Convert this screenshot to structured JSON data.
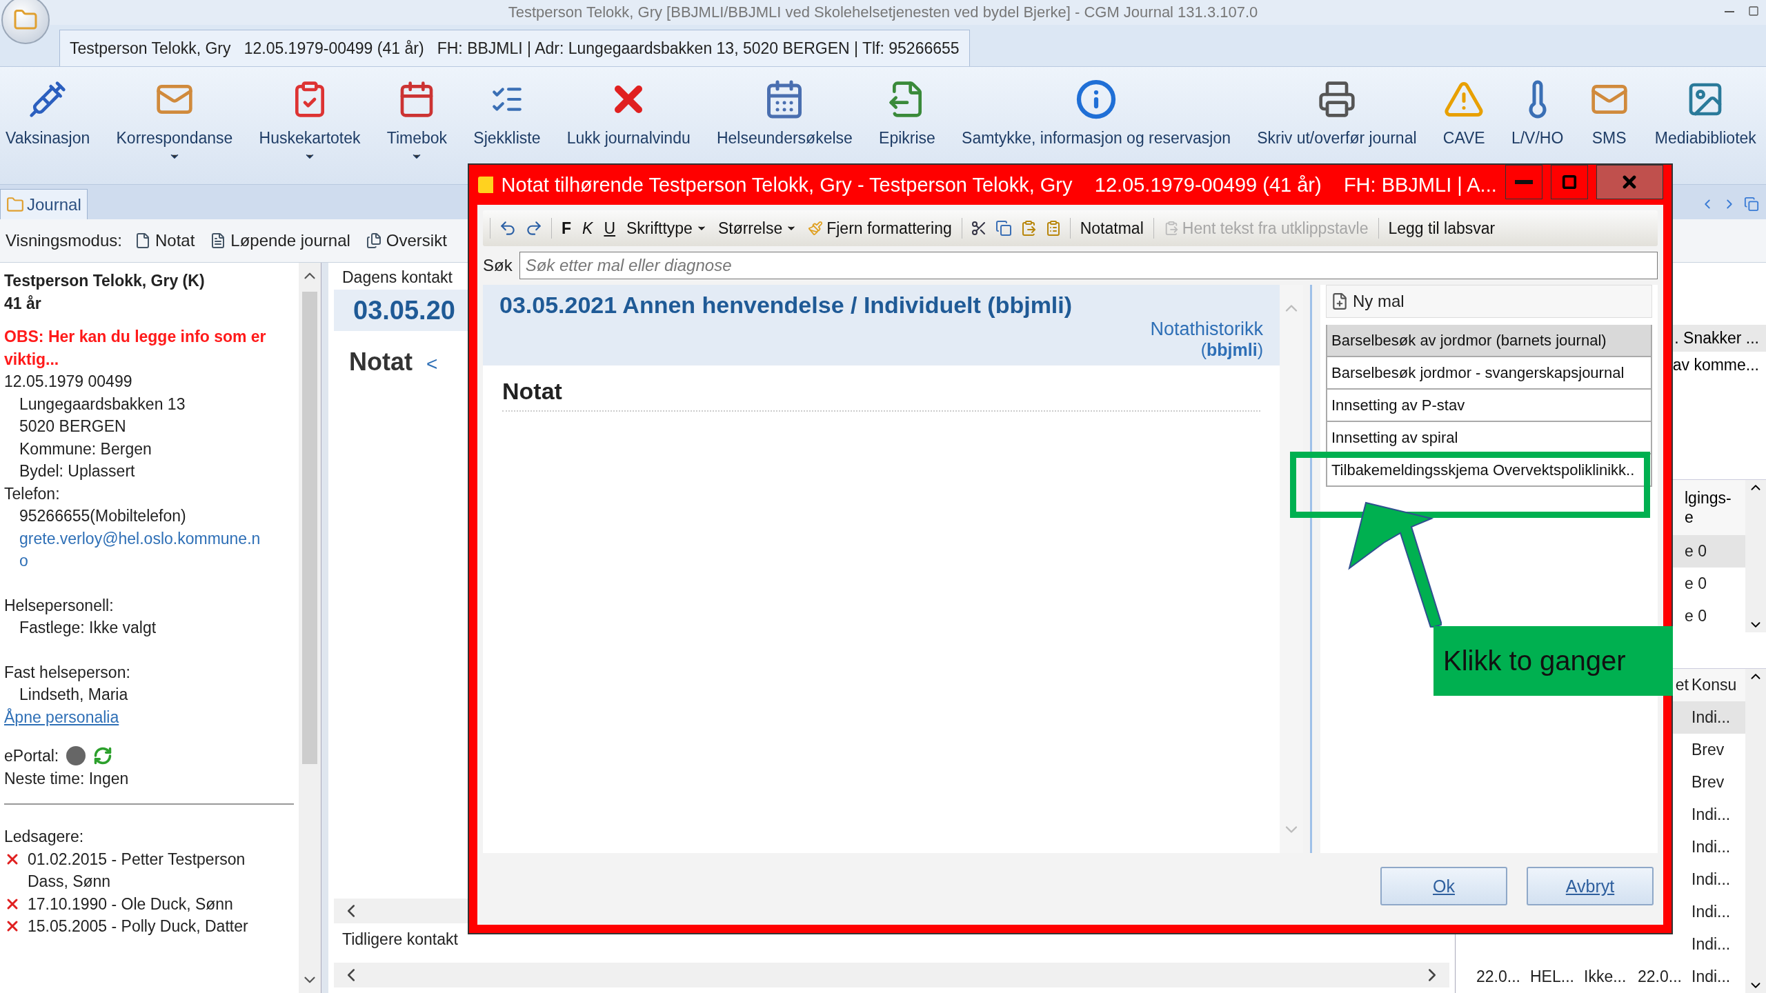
{
  "window": {
    "title": "Testperson Telokk, Gry [BBJMLI/BBJMLI ved Skolehelsetjenesten ved bydel Bjerke] - CGM Journal 131.3.107.0"
  },
  "patient_tab": {
    "label": "Testperson Telokk, Gry   12.05.1979-00499 (41 år)   FH: BBJMLI | Adr: Lungegaardsbakken 13, 5020 BERGEN | Tlf: 95266655"
  },
  "ribbon": [
    {
      "label": "Vaksinasjon",
      "dropdown": false
    },
    {
      "label": "Korrespondanse",
      "dropdown": true
    },
    {
      "label": "Huskekartotek",
      "dropdown": true
    },
    {
      "label": "Timebok",
      "dropdown": true
    },
    {
      "label": "Sjekkliste",
      "dropdown": false
    },
    {
      "label": "Lukk journalvindu",
      "dropdown": false
    },
    {
      "label": "Helseundersøkelse",
      "dropdown": false
    },
    {
      "label": "Epikrise",
      "dropdown": false
    },
    {
      "label": "Samtykke, informasjon og reservasjon",
      "dropdown": false
    },
    {
      "label": "Skriv ut/overfør journal",
      "dropdown": false
    },
    {
      "label": "CAVE",
      "dropdown": false
    },
    {
      "label": "L/V/HO",
      "dropdown": false
    },
    {
      "label": "SMS",
      "dropdown": false
    },
    {
      "label": "Mediabibliotek",
      "dropdown": false
    }
  ],
  "journal_tab": {
    "label": "Journal"
  },
  "view_mode": {
    "label": "Visningsmodus:",
    "options": [
      {
        "label": "Notat"
      },
      {
        "label": "Løpende journal"
      },
      {
        "label": "Oversikt"
      }
    ]
  },
  "patient": {
    "name": "Testperson Telokk, Gry (K)",
    "age": "41 år",
    "obs": "OBS: Her kan du legge info som er viktig...",
    "birth": "12.05.1979 00499",
    "address": [
      "Lungegaardsbakken 13",
      "5020 BERGEN",
      "Kommune: Bergen",
      "Bydel: Uplassert"
    ],
    "phone_label": "Telefon:",
    "phone": "95266655(Mobiltelefon)",
    "email": "grete.verloy@hel.oslo.kommune.no",
    "staff_label": "Helsepersonell:",
    "gp": "Fastlege: Ikke valgt",
    "fixed_label": "Fast helseperson:",
    "fixed": "Lindseth, Maria",
    "open_link": "Åpne personalia",
    "eportal": "ePortal:",
    "next": "Neste time: Ingen",
    "companions_label": "Ledsagere:",
    "companions": [
      "01.02.2015 - Petter Testperson Dass, Sønn",
      "17.10.1990 - Ole Duck, Sønn",
      "15.05.2005 - Polly Duck, Datter"
    ]
  },
  "middle": {
    "today_label": "Dagens kontakt",
    "date": "03.05.20",
    "note": "Notat",
    "prev": "<",
    "earlier_label": "Tidligere kontakt"
  },
  "right": {
    "top_rows": [
      ". Snakker ...",
      "av komme..."
    ],
    "table1": {
      "header": [
        "lgings-",
        "e"
      ],
      "rows": [
        {
          "text": "e 0",
          "selected": true
        },
        {
          "text": "e 0",
          "selected": false
        },
        {
          "text": "e 0",
          "selected": false
        }
      ]
    },
    "table2": {
      "headers": [
        "et",
        "Konsu"
      ],
      "rows": [
        {
          "konsu": "Indi...",
          "selected": true
        },
        {
          "konsu": "Brev",
          "selected": false
        },
        {
          "konsu": "Brev",
          "selected": false
        },
        {
          "konsu": "Indi...",
          "selected": false
        },
        {
          "konsu": "Indi...",
          "selected": false
        },
        {
          "konsu": "Indi...",
          "selected": false
        },
        {
          "konsu": "Indi...",
          "selected": false
        },
        {
          "konsu": "Indi...",
          "selected": false
        },
        {
          "cells": [
            "22.0...",
            "HEL...",
            "Ikke...",
            "22.0...",
            "Indi..."
          ],
          "selected": false
        }
      ]
    }
  },
  "dialog": {
    "title": "Notat tilhørende Testperson Telokk, Gry - Testperson Telokk, Gry    12.05.1979-00499 (41 år)    FH: BBJMLI | A...",
    "toolbar": {
      "format": [
        "F",
        "K",
        "U"
      ],
      "menus": [
        "Skrifttype",
        "Størrelse"
      ],
      "clear": "Fjern formattering",
      "template": "Notatmal",
      "paste": {
        "label": "Hent tekst fra utklippstavle",
        "disabled": true
      },
      "lab": "Legg til labsvar"
    },
    "search": {
      "label": "Søk",
      "placeholder": "Søk etter mal eller diagnose"
    },
    "note_title": "03.05.2021 Annen henvendelse / Individuelt (bbjmli)",
    "history": "Notathistorikk",
    "history_user": "(**bbjmli**)",
    "heading": "Notat",
    "new_template": "Ny mal",
    "templates": [
      {
        "label": "Barselbesøk av jordmor (barnets journal)",
        "selected": true
      },
      {
        "label": "Barselbesøk jordmor - svangerskapsjournal",
        "selected": false
      },
      {
        "label": "Innsetting av P-stav",
        "selected": false
      },
      {
        "label": "Innsetting av spiral",
        "selected": false
      },
      {
        "label": "Tilbakemeldingsskjema Overvektspoliklinikk..",
        "selected": false
      }
    ],
    "buttons": [
      "Ok",
      "Avbryt"
    ]
  },
  "callout": {
    "text": "Klikk to ganger"
  }
}
